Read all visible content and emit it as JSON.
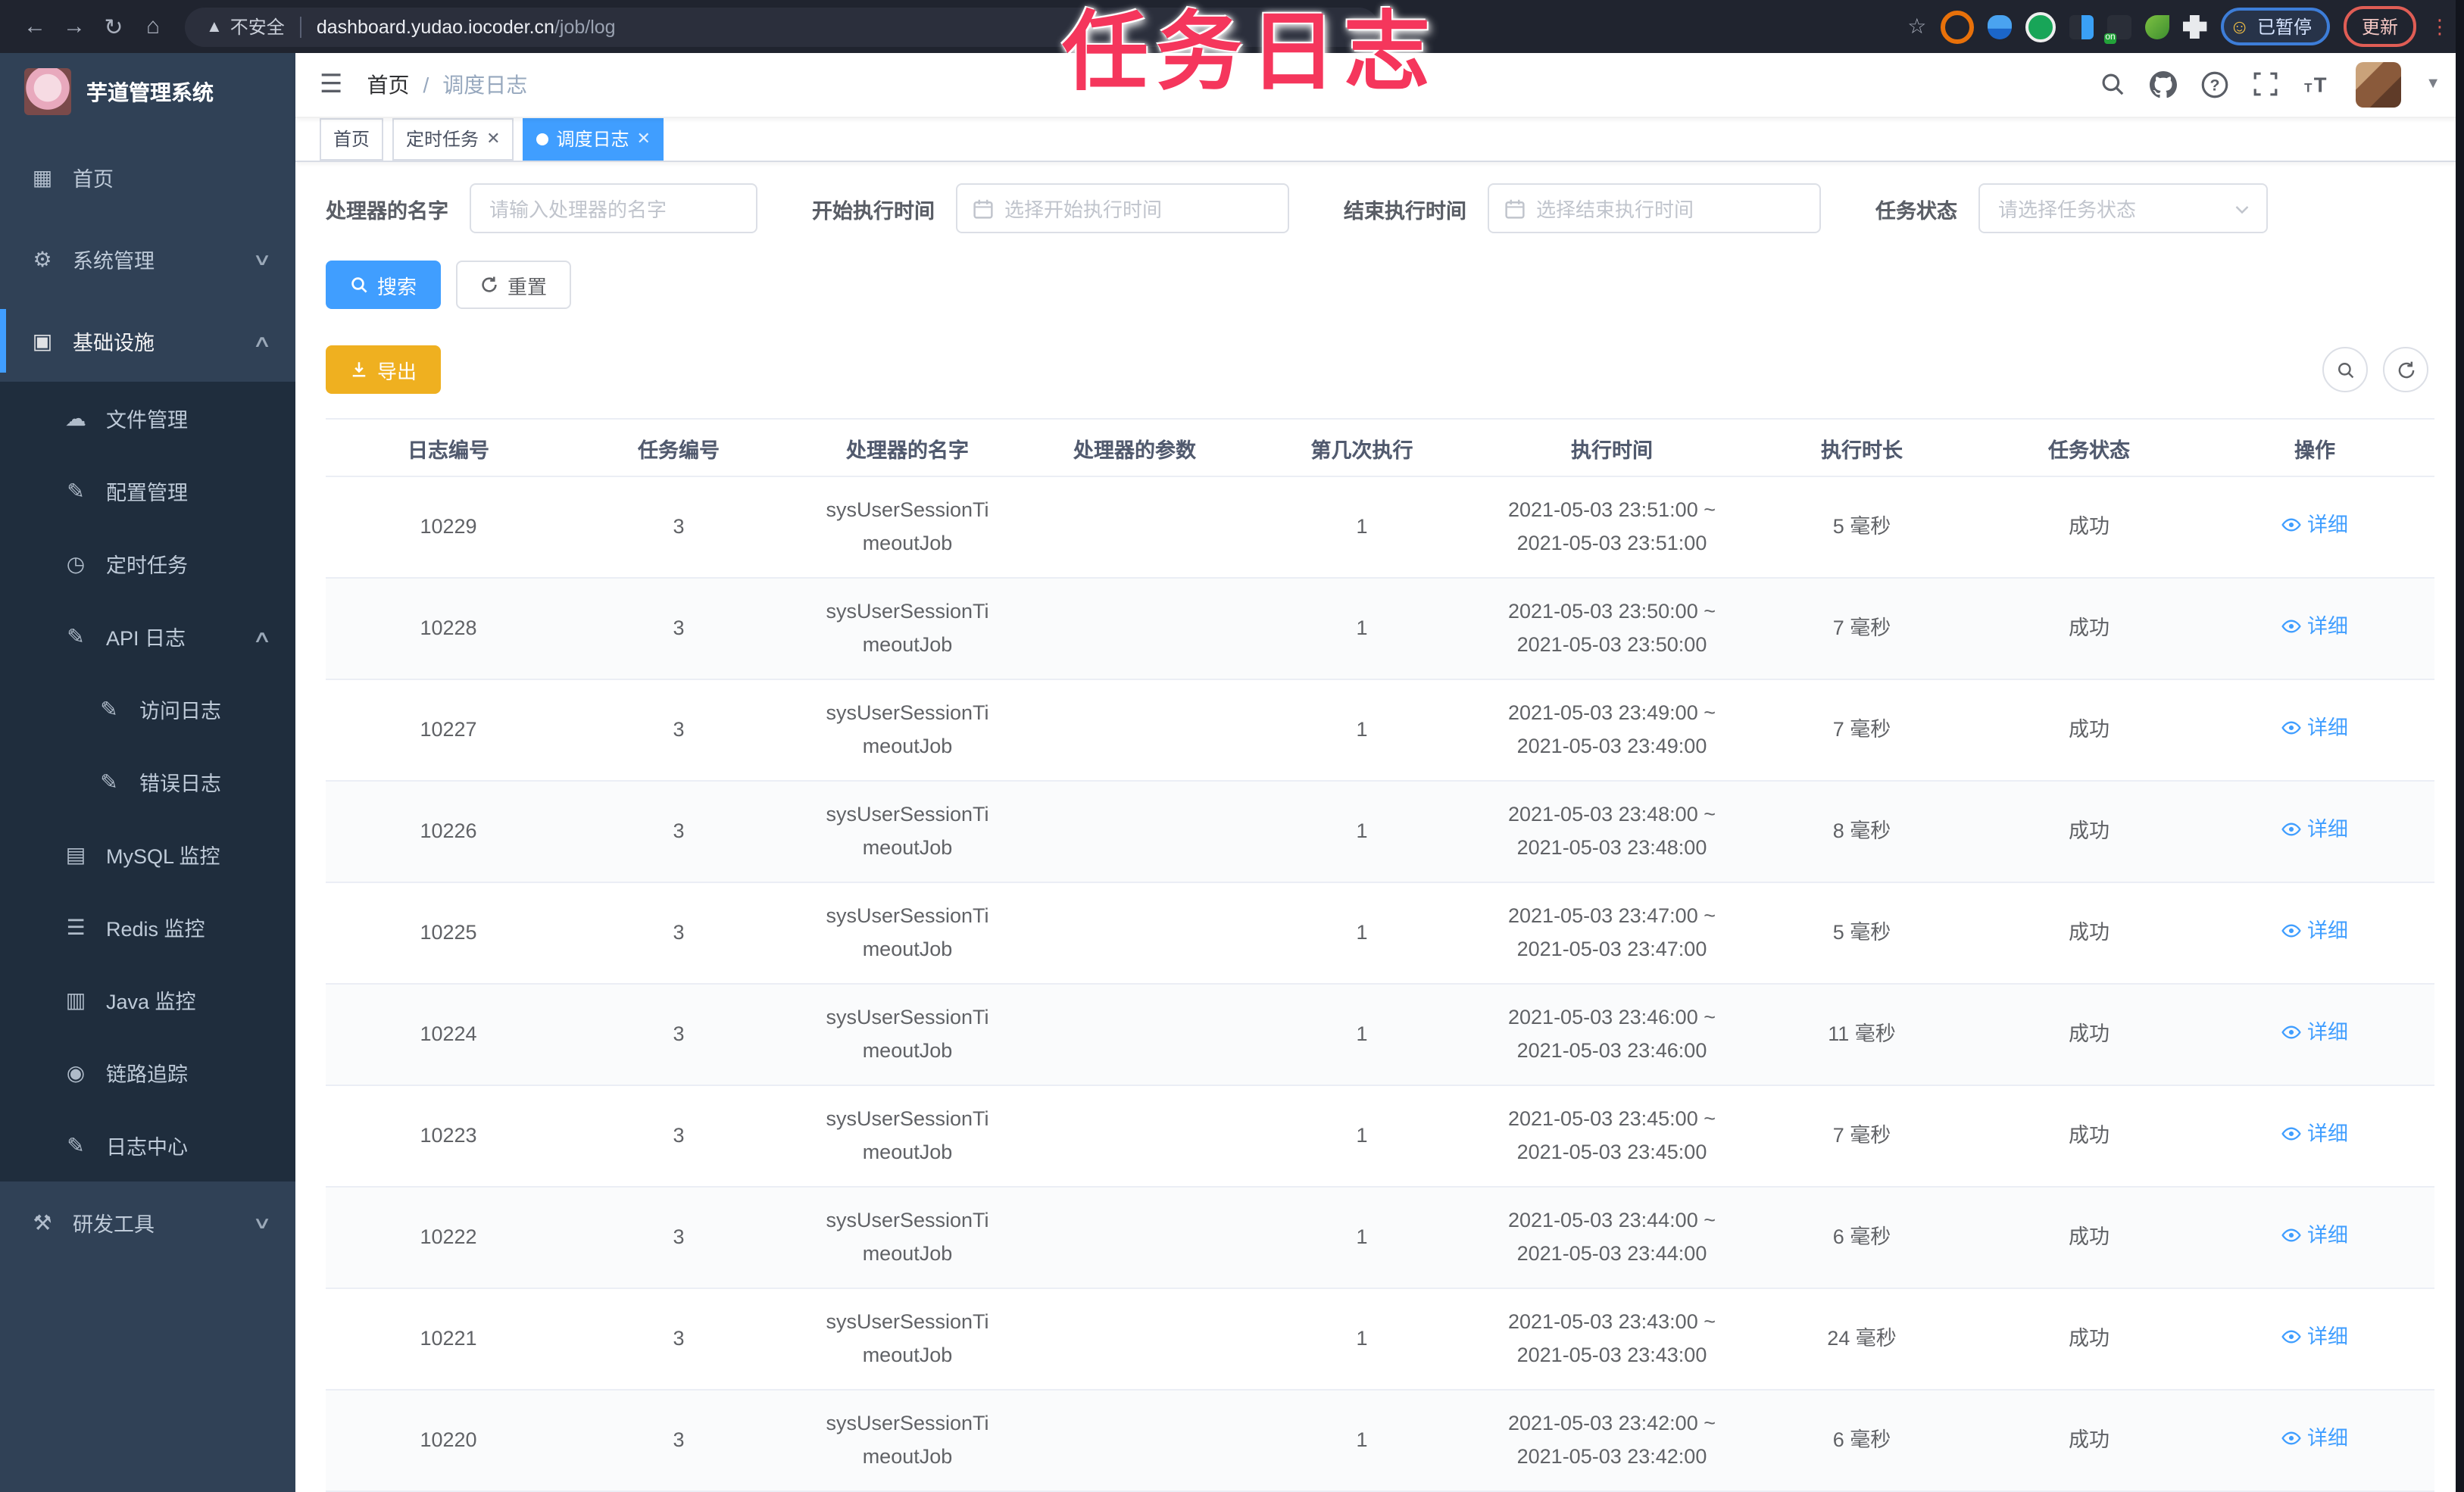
{
  "browser": {
    "security_label": "不安全",
    "url_host": "dashboard.yudao.iocoder.cn",
    "url_path": "/job/log",
    "profile_chip_label": "已暂停",
    "update_button_label": "更新"
  },
  "overlay": {
    "watermark_text": "任务日志",
    "watermark_color": "#f5365c"
  },
  "colors": {
    "accent_blue": "#409eff",
    "warning_yellow": "#efb020",
    "sidebar_bg": "#304156",
    "sidebar_submenu_bg": "#1f2d3d",
    "browser_bar_bg": "#20242f"
  },
  "sidebar": {
    "app_title": "芋道管理系统",
    "items": [
      {
        "label": "首页",
        "icon": "dashboard-icon",
        "level": 1
      },
      {
        "label": "系统管理",
        "icon": "gear-icon",
        "level": 1,
        "chevron": "down"
      },
      {
        "label": "基础设施",
        "icon": "monitor-icon",
        "level": 1,
        "chevron": "up",
        "active": true
      },
      {
        "label": "文件管理",
        "icon": "upload-cloud-icon",
        "level": 2
      },
      {
        "label": "配置管理",
        "icon": "edit-icon",
        "level": 2
      },
      {
        "label": "定时任务",
        "icon": "timer-icon",
        "level": 2
      },
      {
        "label": "API 日志",
        "icon": "log-icon",
        "level": 2,
        "chevron": "up"
      },
      {
        "label": "访问日志",
        "icon": "log-icon",
        "level": 3
      },
      {
        "label": "错误日志",
        "icon": "log-icon",
        "level": 3
      },
      {
        "label": "MySQL 监控",
        "icon": "chart-icon",
        "level": 2
      },
      {
        "label": "Redis 监控",
        "icon": "database-icon",
        "level": 2
      },
      {
        "label": "Java 监控",
        "icon": "java-monitor-icon",
        "level": 2
      },
      {
        "label": "链路追踪",
        "icon": "eye-icon",
        "level": 2
      },
      {
        "label": "日志中心",
        "icon": "log-center-icon",
        "level": 2
      },
      {
        "label": "研发工具",
        "icon": "tools-icon",
        "level": 1,
        "chevron": "down"
      }
    ]
  },
  "header": {
    "breadcrumb_home": "首页",
    "breadcrumb_separator": "/",
    "breadcrumb_current": "调度日志"
  },
  "tabs": [
    {
      "label": "首页",
      "closable": false,
      "active": false
    },
    {
      "label": "定时任务",
      "closable": true,
      "active": false
    },
    {
      "label": "调度日志",
      "closable": true,
      "active": true
    }
  ],
  "filters": {
    "handler_label": "处理器的名字",
    "handler_placeholder": "请输入处理器的名字",
    "start_label": "开始执行时间",
    "start_placeholder": "选择开始执行时间",
    "end_label": "结束执行时间",
    "end_placeholder": "选择结束执行时间",
    "status_label": "任务状态",
    "status_placeholder": "请选择任务状态",
    "search_button": "搜索",
    "reset_button": "重置",
    "export_button": "导出"
  },
  "table": {
    "headers": [
      "日志编号",
      "任务编号",
      "处理器的名字",
      "处理器的参数",
      "第几次执行",
      "执行时间",
      "执行时长",
      "任务状态",
      "操作"
    ],
    "action_label": "详细",
    "rows": [
      {
        "log_id": "10229",
        "job_id": "3",
        "handler": "sysUserSessionTimeoutJob",
        "param": "",
        "count": "1",
        "time_start": "2021-05-03 23:51:00",
        "time_end": "2021-05-03 23:51:00",
        "duration": "5 毫秒",
        "status": "成功"
      },
      {
        "log_id": "10228",
        "job_id": "3",
        "handler": "sysUserSessionTimeoutJob",
        "param": "",
        "count": "1",
        "time_start": "2021-05-03 23:50:00",
        "time_end": "2021-05-03 23:50:00",
        "duration": "7 毫秒",
        "status": "成功"
      },
      {
        "log_id": "10227",
        "job_id": "3",
        "handler": "sysUserSessionTimeoutJob",
        "param": "",
        "count": "1",
        "time_start": "2021-05-03 23:49:00",
        "time_end": "2021-05-03 23:49:00",
        "duration": "7 毫秒",
        "status": "成功"
      },
      {
        "log_id": "10226",
        "job_id": "3",
        "handler": "sysUserSessionTimeoutJob",
        "param": "",
        "count": "1",
        "time_start": "2021-05-03 23:48:00",
        "time_end": "2021-05-03 23:48:00",
        "duration": "8 毫秒",
        "status": "成功"
      },
      {
        "log_id": "10225",
        "job_id": "3",
        "handler": "sysUserSessionTimeoutJob",
        "param": "",
        "count": "1",
        "time_start": "2021-05-03 23:47:00",
        "time_end": "2021-05-03 23:47:00",
        "duration": "5 毫秒",
        "status": "成功"
      },
      {
        "log_id": "10224",
        "job_id": "3",
        "handler": "sysUserSessionTimeoutJob",
        "param": "",
        "count": "1",
        "time_start": "2021-05-03 23:46:00",
        "time_end": "2021-05-03 23:46:00",
        "duration": "11 毫秒",
        "status": "成功"
      },
      {
        "log_id": "10223",
        "job_id": "3",
        "handler": "sysUserSessionTimeoutJob",
        "param": "",
        "count": "1",
        "time_start": "2021-05-03 23:45:00",
        "time_end": "2021-05-03 23:45:00",
        "duration": "7 毫秒",
        "status": "成功"
      },
      {
        "log_id": "10222",
        "job_id": "3",
        "handler": "sysUserSessionTimeoutJob",
        "param": "",
        "count": "1",
        "time_start": "2021-05-03 23:44:00",
        "time_end": "2021-05-03 23:44:00",
        "duration": "6 毫秒",
        "status": "成功"
      },
      {
        "log_id": "10221",
        "job_id": "3",
        "handler": "sysUserSessionTimeoutJob",
        "param": "",
        "count": "1",
        "time_start": "2021-05-03 23:43:00",
        "time_end": "2021-05-03 23:43:00",
        "duration": "24 毫秒",
        "status": "成功"
      },
      {
        "log_id": "10220",
        "job_id": "3",
        "handler": "sysUserSessionTimeoutJob",
        "param": "",
        "count": "1",
        "time_start": "2021-05-03 23:42:00",
        "time_end": "2021-05-03 23:42:00",
        "duration": "6 毫秒",
        "status": "成功"
      }
    ]
  }
}
